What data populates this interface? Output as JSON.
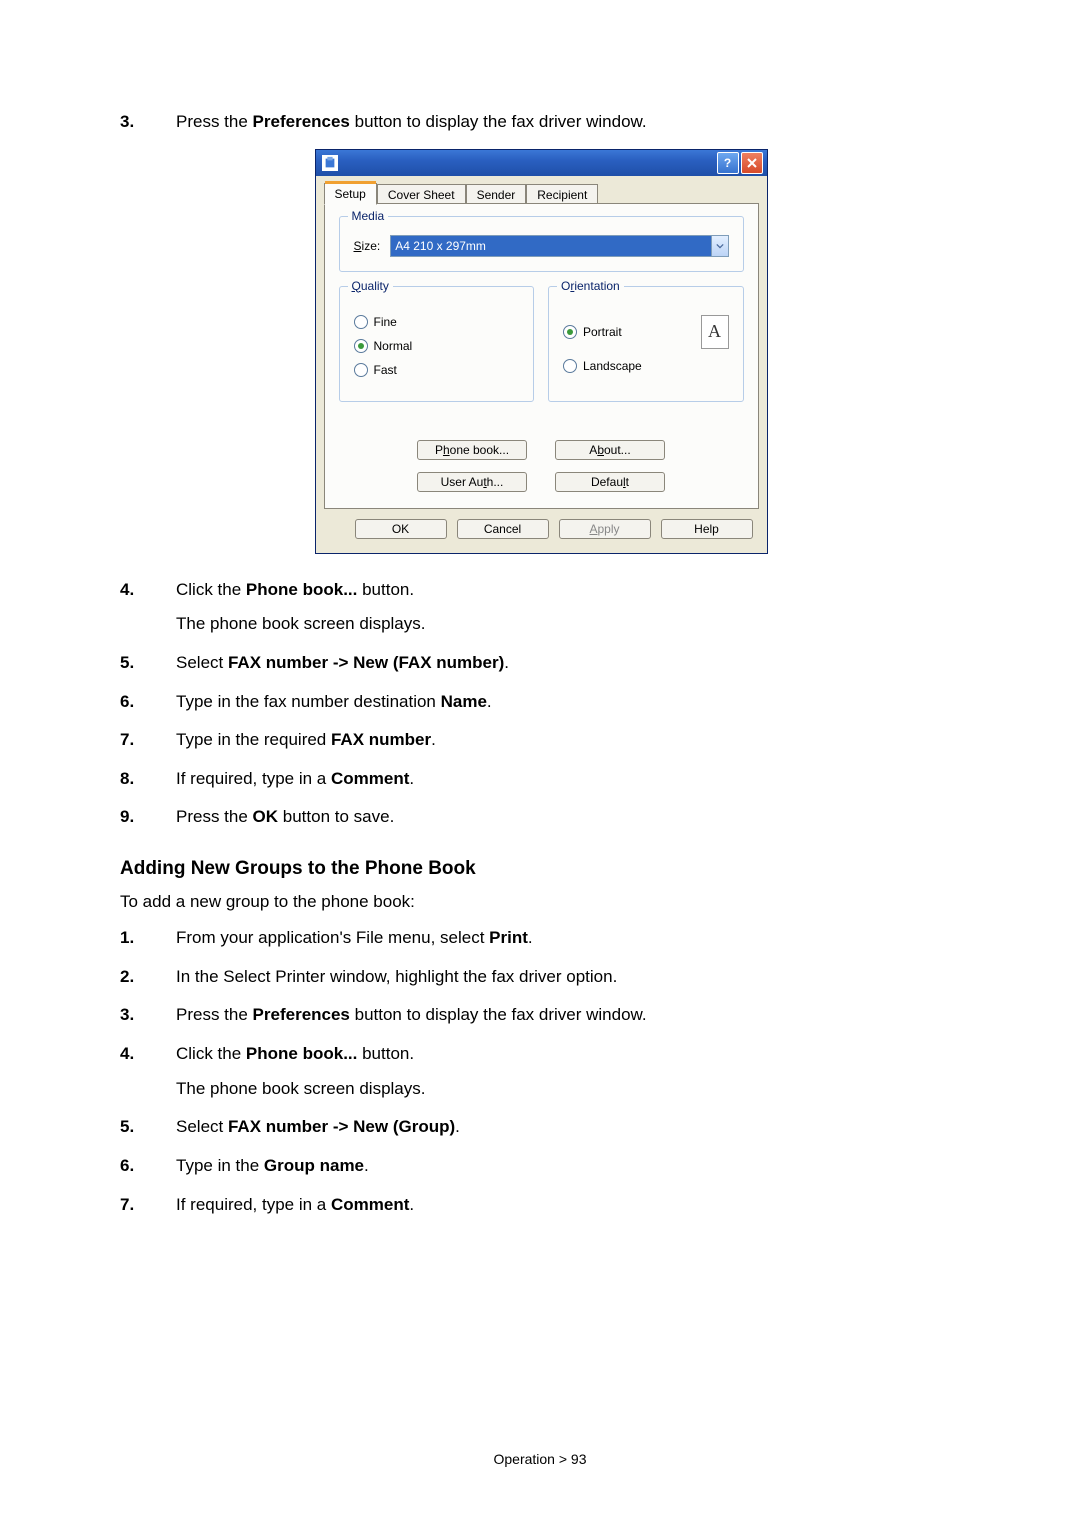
{
  "section_a": {
    "items": [
      {
        "num": "3.",
        "pre": "Press the ",
        "bold": "Preferences",
        "post": " button to display the fax driver window."
      }
    ]
  },
  "dialog": {
    "tabs": [
      "Setup",
      "Cover Sheet",
      "Sender",
      "Recipient"
    ],
    "media": {
      "group": "Media",
      "size_label": "Size:",
      "size_value": "A4 210 x 297mm"
    },
    "quality": {
      "group": "Quality",
      "options": [
        "Fine",
        "Normal",
        "Fast"
      ],
      "selected": "Normal"
    },
    "orientation": {
      "group": "Orientation",
      "options": [
        "Portrait",
        "Landscape"
      ],
      "selected": "Portrait",
      "glyph": "A"
    },
    "buttons": {
      "phone_book": "Phone book...",
      "about": "About...",
      "user_auth": "User Auth...",
      "default": "Default"
    },
    "bottom": {
      "ok": "OK",
      "cancel": "Cancel",
      "apply": "Apply",
      "help": "Help"
    },
    "title_help": "?",
    "title_close": "×"
  },
  "section_b": {
    "items": [
      {
        "num": "4.",
        "pre": "Click the ",
        "bold": "Phone book...",
        "post": " button.",
        "sub": "The phone book screen displays."
      },
      {
        "num": "5.",
        "pre": "Select ",
        "bold": "FAX number -> New (FAX number)",
        "post": "."
      },
      {
        "num": "6.",
        "pre": "Type in the fax number destination ",
        "bold": "Name",
        "post": "."
      },
      {
        "num": "7.",
        "pre": "Type in the required ",
        "bold": "FAX number",
        "post": "."
      },
      {
        "num": "8.",
        "pre": "If required, type in a ",
        "bold": "Comment",
        "post": "."
      },
      {
        "num": "9.",
        "pre": "Press the ",
        "bold": "OK",
        "post": " button to save."
      }
    ]
  },
  "heading": "Adding New Groups to the Phone Book",
  "intro": "To add a new group to the phone book:",
  "section_c": {
    "items": [
      {
        "num": "1.",
        "pre": "From your application's File menu, select ",
        "bold": "Print",
        "post": "."
      },
      {
        "num": "2.",
        "pre": "In the Select Printer window, highlight the fax driver option.",
        "bold": "",
        "post": ""
      },
      {
        "num": "3.",
        "pre": "Press the ",
        "bold": "Preferences",
        "post": " button to display the fax driver window."
      },
      {
        "num": "4.",
        "pre": "Click the ",
        "bold": "Phone book...",
        "post": " button.",
        "sub": "The phone book screen displays."
      },
      {
        "num": "5.",
        "pre": "Select ",
        "bold": "FAX number -> New (Group)",
        "post": "."
      },
      {
        "num": "6.",
        "pre": "Type in the ",
        "bold": "Group name",
        "post": "."
      },
      {
        "num": "7.",
        "pre": "If required, type in a ",
        "bold": "Comment",
        "post": "."
      }
    ]
  },
  "footer": "Operation > 93"
}
